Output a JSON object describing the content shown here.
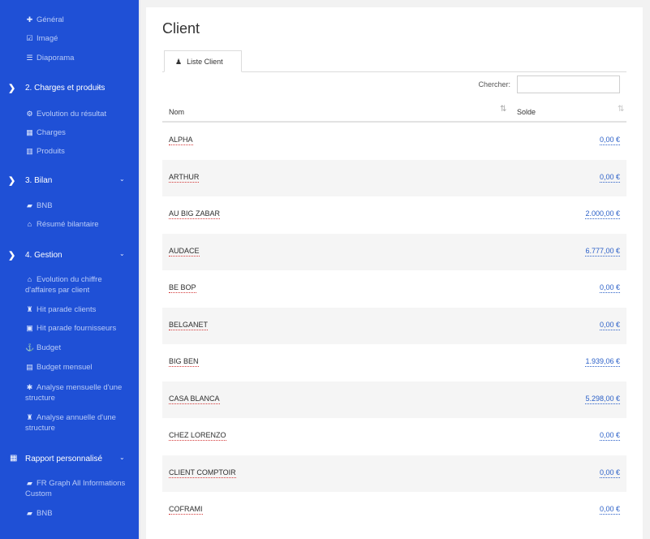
{
  "sidebar": {
    "top_items": [
      {
        "label": "Général",
        "icon": "plus-icon",
        "glyph": "✚"
      },
      {
        "label": "Imagé",
        "icon": "image-check-icon",
        "glyph": "☑"
      },
      {
        "label": "Diaporama",
        "icon": "list-icon",
        "glyph": "☰"
      }
    ],
    "sections": [
      {
        "label": "2. Charges et produits",
        "items": [
          {
            "label": "Evolution du résultat",
            "icon": "chart-icon",
            "glyph": "⚙"
          },
          {
            "label": "Charges",
            "icon": "table-icon",
            "glyph": "▦"
          },
          {
            "label": "Produits",
            "icon": "building-icon",
            "glyph": "▥"
          }
        ]
      },
      {
        "label": "3. Bilan",
        "items": [
          {
            "label": "BNB",
            "icon": "book-icon",
            "glyph": "▰"
          },
          {
            "label": "Résumé bilantaire",
            "icon": "bank-icon",
            "glyph": "⌂"
          }
        ]
      },
      {
        "label": "4. Gestion",
        "items": [
          {
            "label": "Evolution du chiffre d'affaires par client",
            "icon": "bank-icon",
            "glyph": "⌂"
          },
          {
            "label": "Hit parade clients",
            "icon": "trophy-icon",
            "glyph": "♜"
          },
          {
            "label": "Hit parade fournisseurs",
            "icon": "car-icon",
            "glyph": "▣"
          },
          {
            "label": "Budget",
            "icon": "anchor-icon",
            "glyph": "⚓"
          },
          {
            "label": "Budget mensuel",
            "icon": "calendar-icon",
            "glyph": "▤"
          },
          {
            "label": "Analyse mensuelle d'une structure",
            "icon": "asterisk-icon",
            "glyph": "✱"
          },
          {
            "label": "Analyse annuelle d'une structure",
            "icon": "trophy-icon",
            "glyph": "♜"
          }
        ]
      },
      {
        "label": "Rapport personnalisé",
        "items": [
          {
            "label": "FR Graph All Informations Custom",
            "icon": "book-icon",
            "glyph": "▰"
          },
          {
            "label": "BNB",
            "icon": "book-icon",
            "glyph": "▰"
          }
        ]
      }
    ],
    "section_arrow": "❯",
    "chevron": "⌄",
    "grid_glyph": "▦"
  },
  "main": {
    "title": "Client",
    "tab_label": "Liste Client",
    "tab_icon": "user-icon",
    "tab_glyph": "♟",
    "search_label": "Chercher:",
    "search_value": "",
    "columns": {
      "nom": "Nom",
      "solde": "Solde"
    },
    "sort_glyph_nom": "⇅",
    "sort_glyph_solde": "⇅",
    "rows": [
      {
        "name": "ALPHA",
        "solde": "0,00 €"
      },
      {
        "name": "ARTHUR",
        "solde": "0,00 €"
      },
      {
        "name": "AU BIG ZABAR",
        "solde": "2.000,00 €"
      },
      {
        "name": "AUDACE",
        "solde": "6.777,00 €"
      },
      {
        "name": "BE BOP",
        "solde": "0,00 €"
      },
      {
        "name": "BELGANET",
        "solde": "0,00 €"
      },
      {
        "name": "BIG BEN",
        "solde": "1.939,06 €"
      },
      {
        "name": "CASA BLANCA",
        "solde": "5.298,00 €"
      },
      {
        "name": "CHEZ LORENZO",
        "solde": "0,00 €"
      },
      {
        "name": "CLIENT COMPTOIR",
        "solde": "0,00 €"
      },
      {
        "name": "COFRAMI",
        "solde": "0,00 €"
      }
    ]
  },
  "colors": {
    "sidebar_bg": "#1f50d6",
    "link_blue": "#2a5fc7",
    "name_underline": "#d43a3a"
  }
}
